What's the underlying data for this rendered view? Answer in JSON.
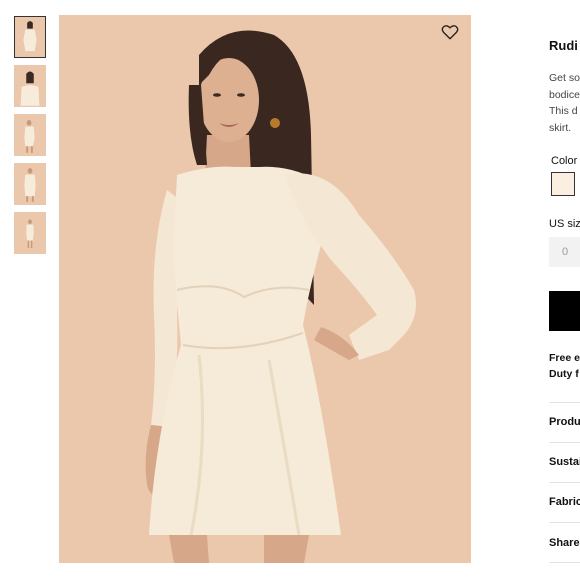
{
  "product": {
    "title": "Rudi",
    "description_lines": [
      "Get so",
      "bodice",
      "This d",
      "skirt."
    ],
    "color_label": "Color",
    "swatch_color": "#fbefe2",
    "size_label": "US siz",
    "size_placeholder": "0",
    "shipping_lines": [
      "Free e",
      "Duty f"
    ]
  },
  "accordion": {
    "items": [
      {
        "label": "Produ"
      },
      {
        "label": "Sustai"
      },
      {
        "label": "Fabric"
      },
      {
        "label": "Share"
      }
    ]
  },
  "gallery": {
    "thumbnail_count": 5,
    "active_index": 0,
    "background_color": "#ebc8ab",
    "dress_color": "#f6ead8"
  },
  "icons": {
    "favorite": "heart-icon"
  }
}
